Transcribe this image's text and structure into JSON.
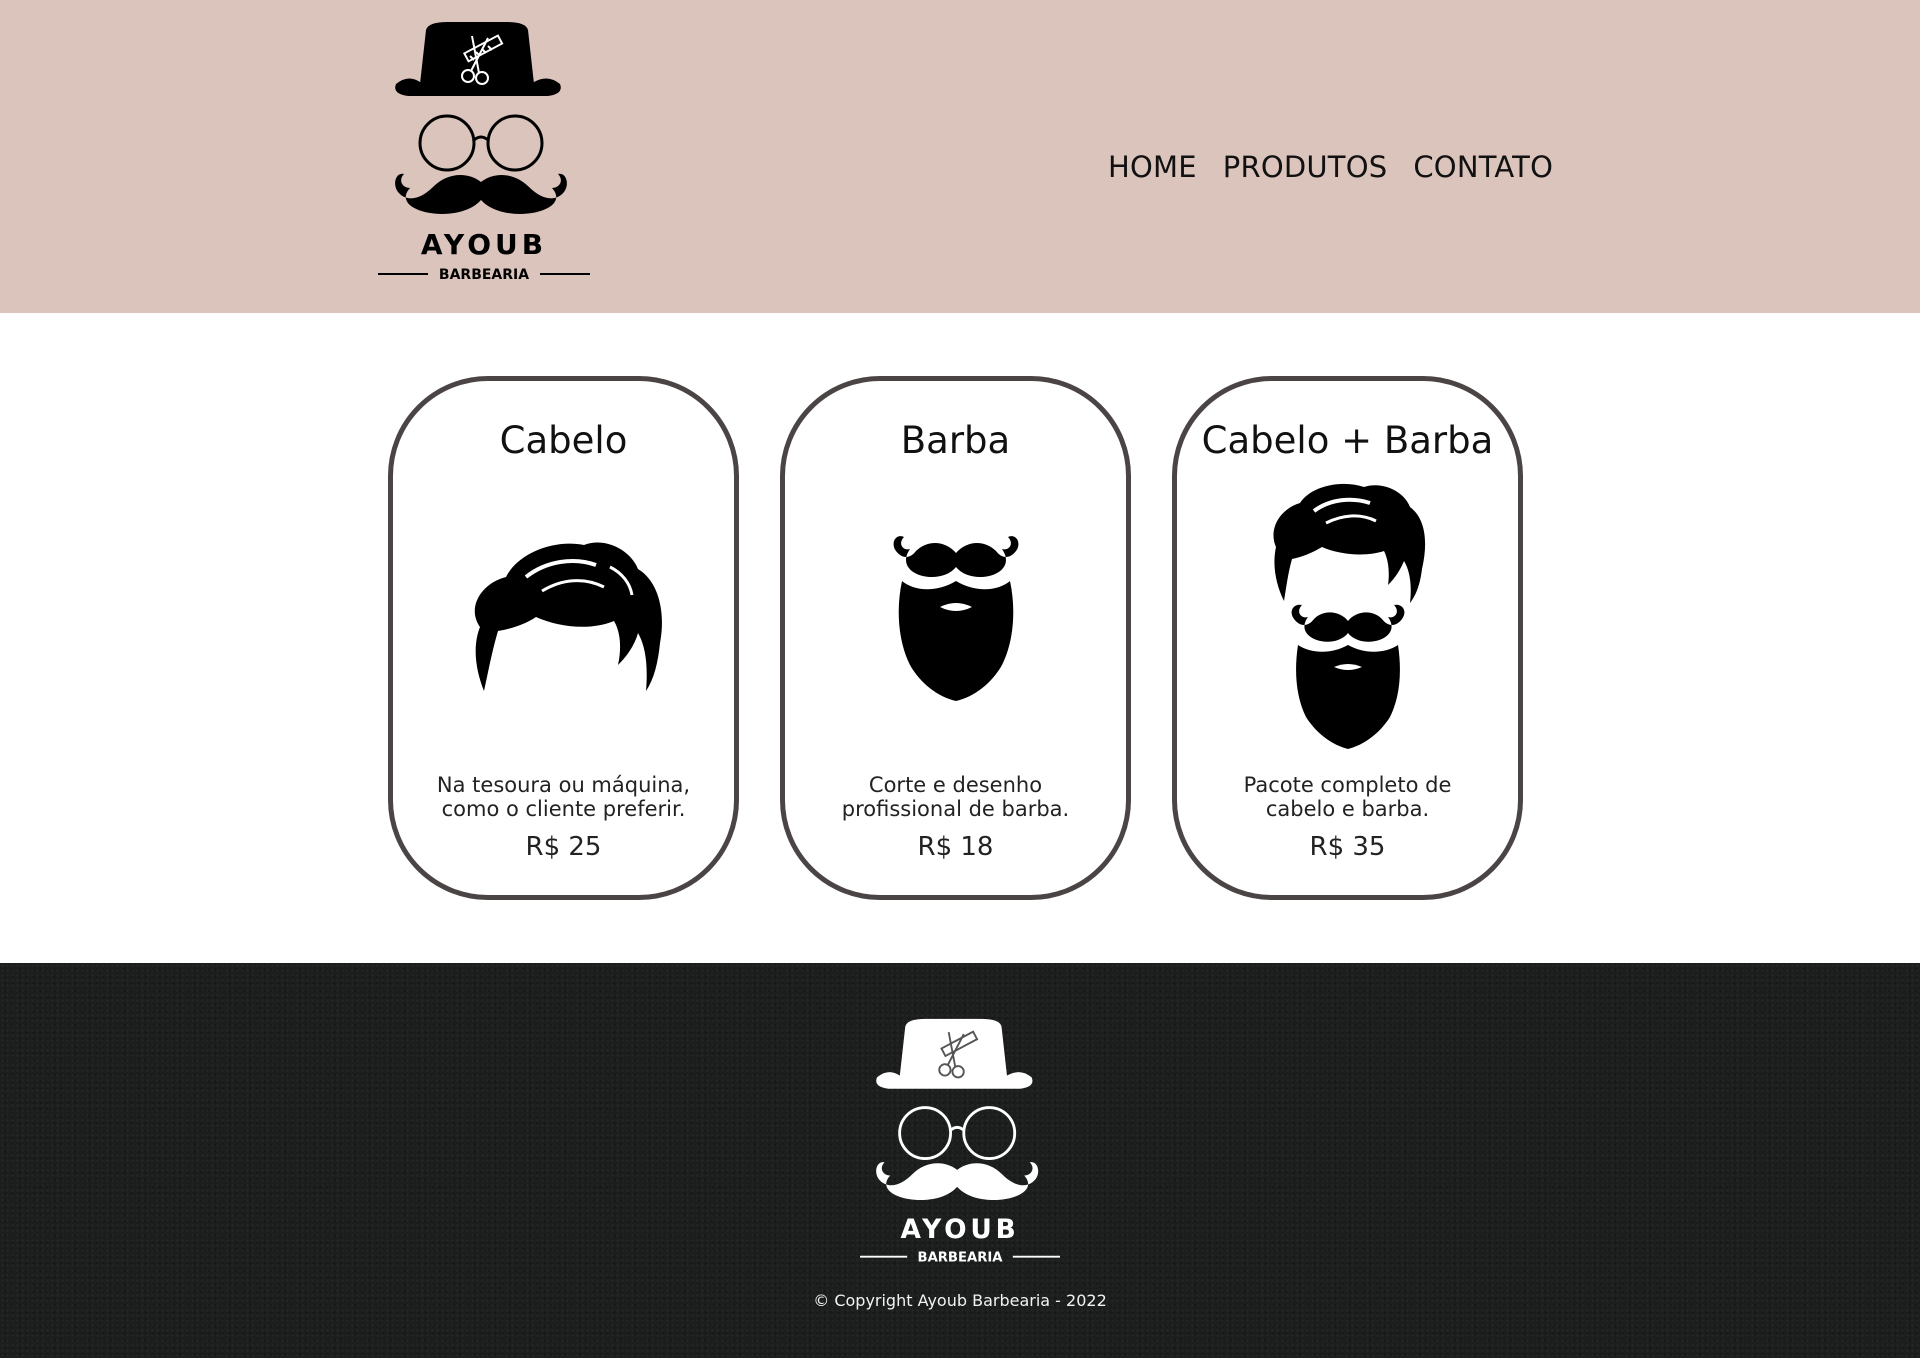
{
  "header": {
    "logo": {
      "brand": "AYOUB",
      "sub": "BARBEARIA"
    },
    "nav": [
      {
        "label": "HOME"
      },
      {
        "label": "PRODUTOS"
      },
      {
        "label": "CONTATO"
      }
    ],
    "background_color": "#dbc4bc"
  },
  "products": [
    {
      "title": "Cabelo",
      "icon": "hair-icon",
      "description": "Na tesoura ou máquina,\ncomo o cliente preferir.",
      "price": "R$ 25"
    },
    {
      "title": "Barba",
      "icon": "beard-icon",
      "description": "Corte e desenho\nprofissional de barba.",
      "price": "R$ 18"
    },
    {
      "title": "Cabelo + Barba",
      "icon": "hair-and-beard-icon",
      "description": "Pacote completo de\ncabelo e barba.",
      "price": "R$ 35"
    }
  ],
  "footer": {
    "logo": {
      "brand": "AYOUB",
      "sub": "BARBEARIA"
    },
    "copyright": "© Copyright Ayoub Barbearia - 2022",
    "background_color": "#1c1d1d"
  },
  "colors": {
    "card_border": "#4a4444"
  }
}
